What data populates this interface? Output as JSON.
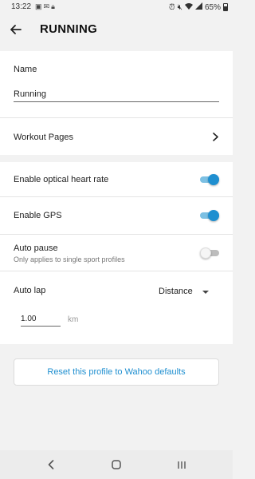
{
  "status_bar": {
    "time": "13:22",
    "left_icons": [
      "image-icon",
      "message-icon",
      "lock-icon"
    ],
    "right_icons": [
      "alarm-icon",
      "mute-icon",
      "wifi-icon",
      "signal-icon"
    ],
    "battery": "65%"
  },
  "header": {
    "title": "RUNNING"
  },
  "name_section": {
    "label": "Name",
    "value": "Running"
  },
  "workout_pages": {
    "label": "Workout Pages"
  },
  "settings": {
    "optical_hr": {
      "label": "Enable optical heart rate",
      "enabled": true
    },
    "gps": {
      "label": "Enable GPS",
      "enabled": true
    },
    "auto_pause": {
      "label": "Auto pause",
      "sublabel": "Only applies to single sport profiles",
      "enabled": false
    },
    "auto_lap": {
      "label": "Auto lap",
      "mode": "Distance",
      "distance_value": "1.00",
      "unit": "km"
    }
  },
  "reset_button": {
    "label": "Reset this profile to Wahoo defaults"
  },
  "colors": {
    "accent": "#1f8fd0",
    "background": "#f2f2f2",
    "card": "#ffffff"
  },
  "nav_bar": {
    "buttons": [
      "back-icon",
      "home-icon",
      "recents-icon"
    ]
  }
}
